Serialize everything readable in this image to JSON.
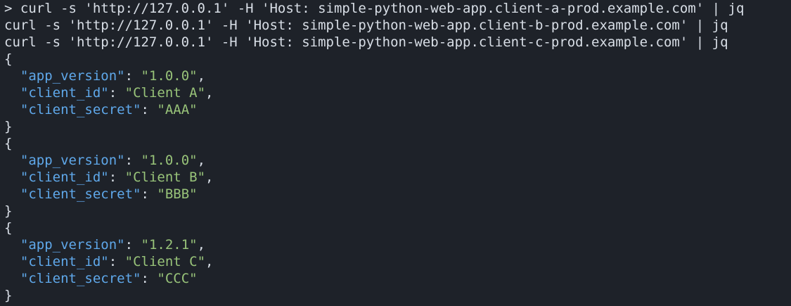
{
  "terminal": {
    "commands": [
      {
        "text": "> curl -s 'http://127.0.0.1' -H 'Host: simple-python-web-app.client-a-prod.example.com' | jq"
      },
      {
        "text": "curl -s 'http://127.0.0.1' -H 'Host: simple-python-web-app.client-b-prod.example.com' | jq"
      },
      {
        "text": "curl -s 'http://127.0.0.1' -H 'Host: simple-python-web-app.client-c-prod.example.com' | jq"
      }
    ],
    "responses": [
      {
        "open": "{",
        "close": "}",
        "fields": [
          {
            "key": "\"app_version\"",
            "value": "\"1.0.0\"",
            "sep": ": ",
            "end": ","
          },
          {
            "key": "\"client_id\"",
            "value": "\"Client A\"",
            "sep": ": ",
            "end": ","
          },
          {
            "key": "\"client_secret\"",
            "value": "\"AAA\"",
            "sep": ": ",
            "end": ""
          }
        ]
      },
      {
        "open": "{",
        "close": "}",
        "fields": [
          {
            "key": "\"app_version\"",
            "value": "\"1.0.0\"",
            "sep": ": ",
            "end": ","
          },
          {
            "key": "\"client_id\"",
            "value": "\"Client B\"",
            "sep": ": ",
            "end": ","
          },
          {
            "key": "\"client_secret\"",
            "value": "\"BBB\"",
            "sep": ": ",
            "end": ""
          }
        ]
      },
      {
        "open": "{",
        "close": "}",
        "fields": [
          {
            "key": "\"app_version\"",
            "value": "\"1.2.1\"",
            "sep": ": ",
            "end": ","
          },
          {
            "key": "\"client_id\"",
            "value": "\"Client C\"",
            "sep": ": ",
            "end": ","
          },
          {
            "key": "\"client_secret\"",
            "value": "\"CCC\"",
            "sep": ": ",
            "end": ""
          }
        ]
      }
    ]
  },
  "colors": {
    "background": "#1e2229",
    "text": "#d8dee6",
    "json_key": "#5fa8ea",
    "json_string": "#98c379"
  }
}
